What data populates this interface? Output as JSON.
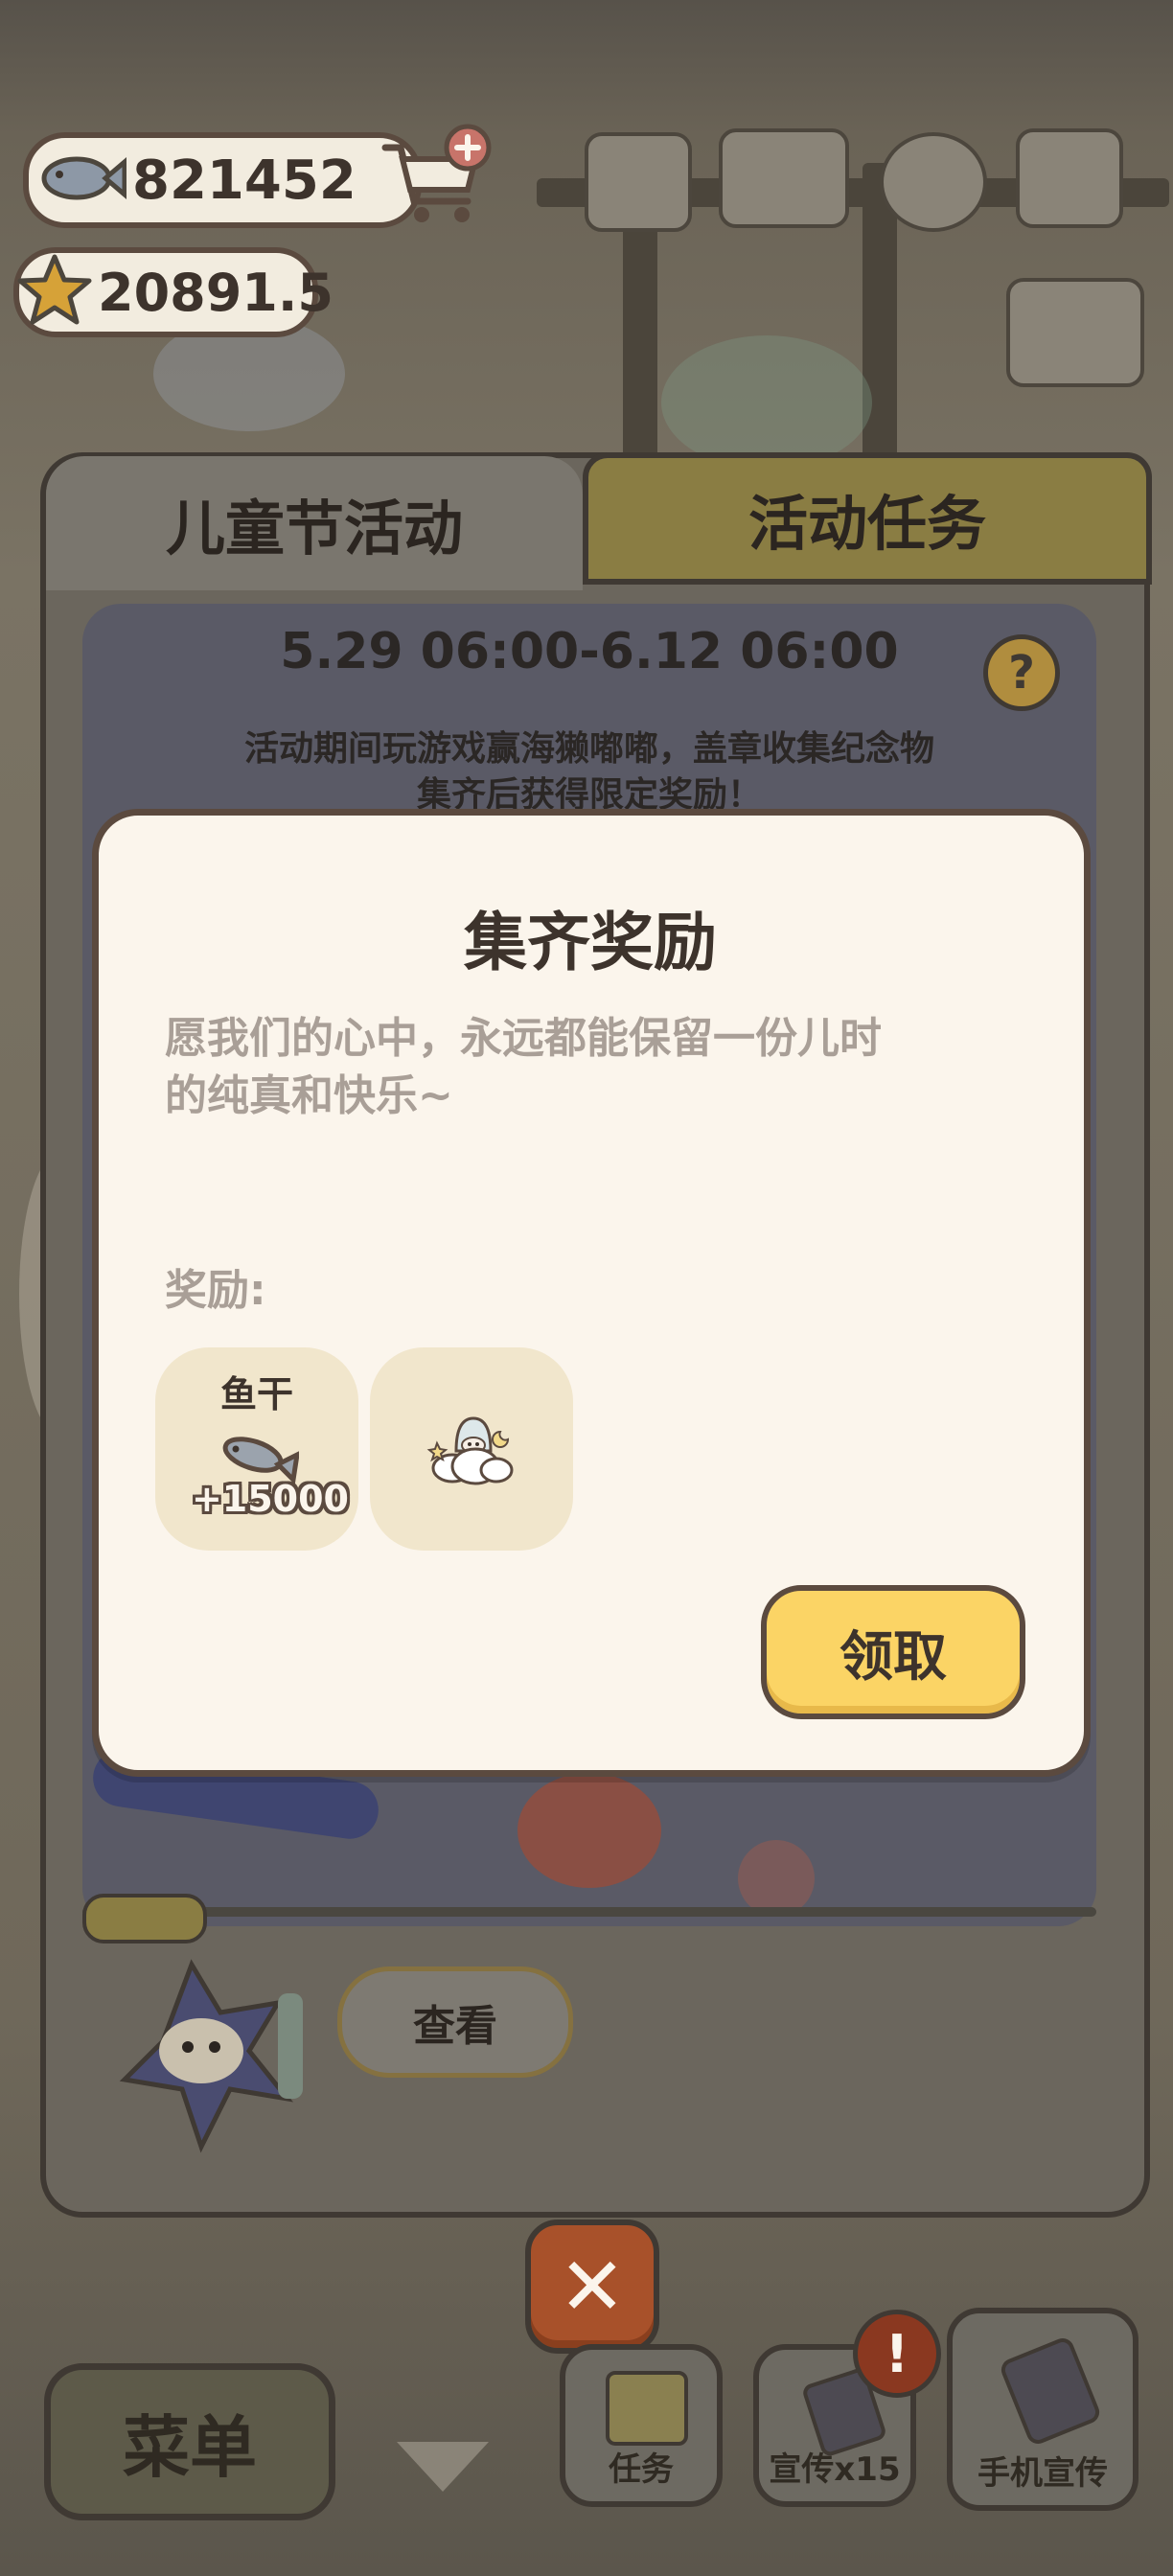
{
  "currency": {
    "fish_amount": "821452",
    "star_amount": "20891.5"
  },
  "panel": {
    "tab_event": "儿童节活动",
    "tab_tasks": "活动任务",
    "date_range": "5.29 06:00-6.12 06:00",
    "help_symbol": "?",
    "description_line1": "活动期间玩游戏赢海獭嘟嘟，盖章收集纪念物",
    "description_line2": "集齐后获得限定奖励！",
    "view_button": "查看"
  },
  "modal": {
    "title": "集齐奖励",
    "desc_line1": "愿我们的心中，永远都能保留一份儿时",
    "desc_line2": "的纯真和快乐~",
    "rewards_label": "奖励:",
    "rewards": [
      {
        "name": "鱼干",
        "amount": "+15000",
        "icon": "dried-fish-icon"
      },
      {
        "icon": "cloud-decoration-icon"
      }
    ],
    "claim_button": "领取"
  },
  "bottom_bar": {
    "close_symbol": "✕",
    "menu_label": "菜单",
    "tasks_label": "任务",
    "promo_label": "宣传x15",
    "phone_promo_label": "手机宣传",
    "alert_symbol": "!"
  },
  "colors": {
    "modal_bg": "#fbf5ec",
    "border_brown": "#5b4a3f",
    "claim_yellow": "#fbd465",
    "close_orange": "#a8512a"
  }
}
